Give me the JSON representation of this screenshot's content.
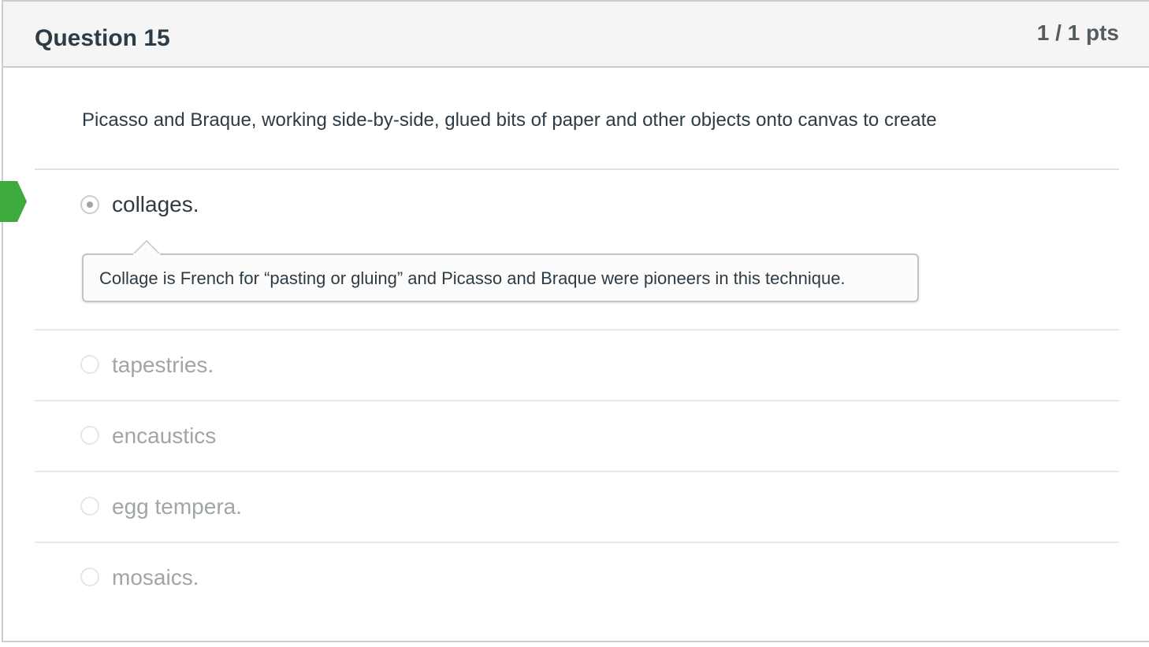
{
  "question": {
    "title": "Question 15",
    "points": "1 / 1 pts",
    "text": "Picasso and Braque, working side-by-side, glued bits of paper and other objects onto canvas to create"
  },
  "answers": [
    {
      "label": "collages.",
      "selected": true,
      "correct": true,
      "comment": "Collage is French for “pasting or gluing” and Picasso and Braque were pioneers in this technique."
    },
    {
      "label": "tapestries.",
      "selected": false
    },
    {
      "label": "encaustics",
      "selected": false
    },
    {
      "label": "egg tempera.",
      "selected": false
    },
    {
      "label": "mosaics.",
      "selected": false
    }
  ],
  "colors": {
    "correct_marker": "#3faa3c",
    "border": "#c7cdd1",
    "header_bg": "#f5f5f5",
    "unselected_text": "#a0a5a9"
  },
  "icons": {
    "correct_marker": "correct-answer-arrow-icon",
    "radio": "radio-button-icon"
  }
}
